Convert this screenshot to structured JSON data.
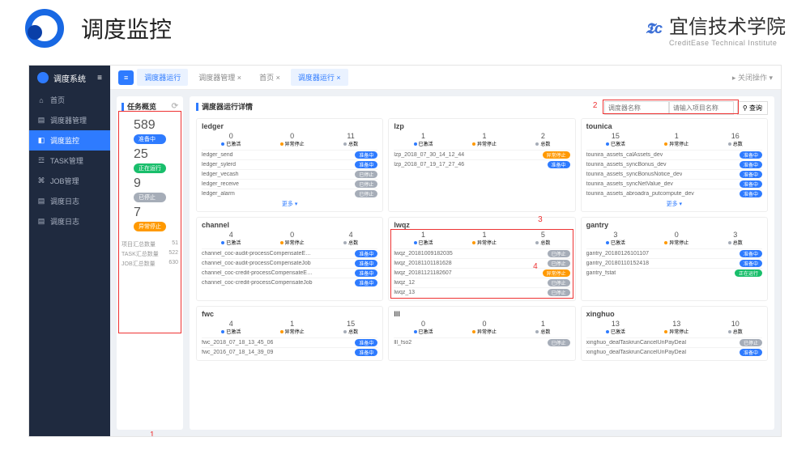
{
  "header": {
    "title": "调度监控",
    "org_cn": "宜信技术学院",
    "org_en": "CreditEase Technical Institute"
  },
  "app": {
    "brand": "调度系统",
    "nav": [
      {
        "icon": "⌂",
        "label": "首页"
      },
      {
        "icon": "▤",
        "label": "调度器管理"
      },
      {
        "icon": "◧",
        "label": "调度监控"
      },
      {
        "icon": "☲",
        "label": "TASK管理"
      },
      {
        "icon": "⌘",
        "label": "JOB管理"
      },
      {
        "icon": "▤",
        "label": "调度日志"
      },
      {
        "icon": "▤",
        "label": "调度日志"
      }
    ],
    "tabs": {
      "t1": "调度器运行",
      "t2": "调度器管理",
      "t3": "首页",
      "t4": "调度器运行",
      "right": "关闭操作"
    }
  },
  "overview": {
    "title": "任务概览",
    "items": [
      {
        "num": "589",
        "badge": "准备中",
        "cls": "b-blue"
      },
      {
        "num": "25",
        "badge": "正在运行",
        "cls": "b-green"
      },
      {
        "num": "9",
        "badge": "已停止",
        "cls": "b-gray"
      },
      {
        "num": "7",
        "badge": "异常停止",
        "cls": "b-orange"
      }
    ],
    "stats": [
      {
        "k": "项目汇总数量",
        "v": "51"
      },
      {
        "k": "TASK汇总数量",
        "v": "522"
      },
      {
        "k": "JOB汇总数量",
        "v": "630"
      }
    ]
  },
  "detail": {
    "title": "调度器运行详情",
    "search_ph1": "调度器名称",
    "search_ph2": "请输入项目名称",
    "search_btn": "查询",
    "cards": [
      {
        "title": "ledger",
        "stats": [
          {
            "n": "0",
            "l": "已激活",
            "d": "d-blue"
          },
          {
            "n": "0",
            "l": "异常停止",
            "d": "d-orange"
          },
          {
            "n": "11",
            "l": "总数",
            "d": "d-gray"
          }
        ],
        "rows": [
          {
            "name": "ledger_send",
            "badge": "准备中",
            "cls": "b-blue"
          },
          {
            "name": "ledger_sylerd",
            "badge": "准备中",
            "cls": "b-blue"
          },
          {
            "name": "ledger_vecash",
            "badge": "已停止",
            "cls": "b-gray"
          },
          {
            "name": "ledger_receive",
            "badge": "已停止",
            "cls": "b-gray"
          },
          {
            "name": "ledger_alarm",
            "badge": "已停止",
            "cls": "b-gray"
          }
        ],
        "more": "更多 ▾"
      },
      {
        "title": "lzp",
        "stats": [
          {
            "n": "1",
            "l": "已激活",
            "d": "d-blue"
          },
          {
            "n": "1",
            "l": "异常停止",
            "d": "d-orange"
          },
          {
            "n": "2",
            "l": "总数",
            "d": "d-gray"
          }
        ],
        "rows": [
          {
            "name": "lzp_2018_07_30_14_12_44",
            "badge": "异常停止",
            "cls": "b-orange"
          },
          {
            "name": "lzp_2018_07_19_17_27_46",
            "badge": "准备中",
            "cls": "b-blue"
          }
        ]
      },
      {
        "title": "tounica",
        "stats": [
          {
            "n": "15",
            "l": "已激活",
            "d": "d-blue"
          },
          {
            "n": "1",
            "l": "异常停止",
            "d": "d-orange"
          },
          {
            "n": "16",
            "l": "总数",
            "d": "d-gray"
          }
        ],
        "rows": [
          {
            "name": "tounira_assets_calAssets_dev",
            "badge": "准备中",
            "cls": "b-blue"
          },
          {
            "name": "tounira_assets_syncBonus_dev",
            "badge": "准备中",
            "cls": "b-blue"
          },
          {
            "name": "tounira_assets_syncBonusNotice_dev",
            "badge": "准备中",
            "cls": "b-blue"
          },
          {
            "name": "tounira_assets_syncNetValue_dev",
            "badge": "准备中",
            "cls": "b-blue"
          },
          {
            "name": "tounira_assets_abroadra_putcompute_dev",
            "badge": "准备中",
            "cls": "b-blue"
          }
        ],
        "more": "更多 ▾"
      },
      {
        "title": "channel",
        "stats": [
          {
            "n": "4",
            "l": "已激活",
            "d": "d-blue"
          },
          {
            "n": "0",
            "l": "异常停止",
            "d": "d-orange"
          },
          {
            "n": "4",
            "l": "总数",
            "d": "d-gray"
          }
        ],
        "rows": [
          {
            "name": "channel_coc-audit-processCompensateEmailJob",
            "badge": "准备中",
            "cls": "b-blue"
          },
          {
            "name": "channel_coc-audit-processCompensateJob",
            "badge": "准备中",
            "cls": "b-blue"
          },
          {
            "name": "channel_coc-credit-processCompensateEmailJob",
            "badge": "准备中",
            "cls": "b-blue"
          },
          {
            "name": "channel_coc-credit-processCompensateJob",
            "badge": "准备中",
            "cls": "b-blue"
          }
        ]
      },
      {
        "title": "lwqz",
        "boxed": true,
        "stats": [
          {
            "n": "1",
            "l": "已激活",
            "d": "d-blue"
          },
          {
            "n": "1",
            "l": "异常停止",
            "d": "d-orange"
          },
          {
            "n": "5",
            "l": "总数",
            "d": "d-gray"
          }
        ],
        "rows": [
          {
            "name": "lwqz_20181009182035",
            "badge": "已停止",
            "cls": "b-gray"
          },
          {
            "name": "lwqz_20181101181628",
            "badge": "已停止",
            "cls": "b-gray"
          },
          {
            "name": "lwqz_20181121182607",
            "badge": "异常停止",
            "cls": "b-orange"
          },
          {
            "name": "lwqz_12",
            "badge": "已停止",
            "cls": "b-gray"
          },
          {
            "name": "lwqz_13",
            "badge": "已停止",
            "cls": "b-gray"
          }
        ]
      },
      {
        "title": "gantry",
        "stats": [
          {
            "n": "3",
            "l": "已激活",
            "d": "d-blue"
          },
          {
            "n": "0",
            "l": "异常停止",
            "d": "d-orange"
          },
          {
            "n": "3",
            "l": "总数",
            "d": "d-gray"
          }
        ],
        "rows": [
          {
            "name": "gantry_20180126101107",
            "badge": "准备中",
            "cls": "b-blue"
          },
          {
            "name": "gantry_20180110152418",
            "badge": "准备中",
            "cls": "b-blue"
          },
          {
            "name": "gantry_fstat",
            "badge": "正在运行",
            "cls": "b-green"
          }
        ]
      },
      {
        "title": "fwc",
        "stats": [
          {
            "n": "4",
            "l": "已激活",
            "d": "d-blue"
          },
          {
            "n": "1",
            "l": "异常停止",
            "d": "d-orange"
          },
          {
            "n": "15",
            "l": "总数",
            "d": "d-gray"
          }
        ],
        "rows": [
          {
            "name": "fwc_2018_07_18_13_45_06",
            "badge": "准备中",
            "cls": "b-blue"
          },
          {
            "name": "fwc_2016_07_18_14_39_09",
            "badge": "准备中",
            "cls": "b-blue"
          }
        ]
      },
      {
        "title": "lll",
        "stats": [
          {
            "n": "0",
            "l": "已激活",
            "d": "d-blue"
          },
          {
            "n": "0",
            "l": "异常停止",
            "d": "d-orange"
          },
          {
            "n": "1",
            "l": "总数",
            "d": "d-gray"
          }
        ],
        "rows": [
          {
            "name": "lll_fso2",
            "badge": "已停止",
            "cls": "b-gray"
          }
        ]
      },
      {
        "title": "xinghuo",
        "stats": [
          {
            "n": "13",
            "l": "已激活",
            "d": "d-blue"
          },
          {
            "n": "13",
            "l": "异常停止",
            "d": "d-orange"
          },
          {
            "n": "10",
            "l": "总数",
            "d": "d-gray"
          }
        ],
        "rows": [
          {
            "name": "xinghuo_dealTaskrunCancelUnPayDeal",
            "badge": "已停止",
            "cls": "b-gray"
          },
          {
            "name": "xinghuo_dealTaskrunCancelUnPayDeal",
            "badge": "准备中",
            "cls": "b-blue"
          }
        ]
      }
    ]
  },
  "markers": {
    "m1": "1",
    "m2": "2",
    "m3": "3",
    "m4": "4"
  }
}
